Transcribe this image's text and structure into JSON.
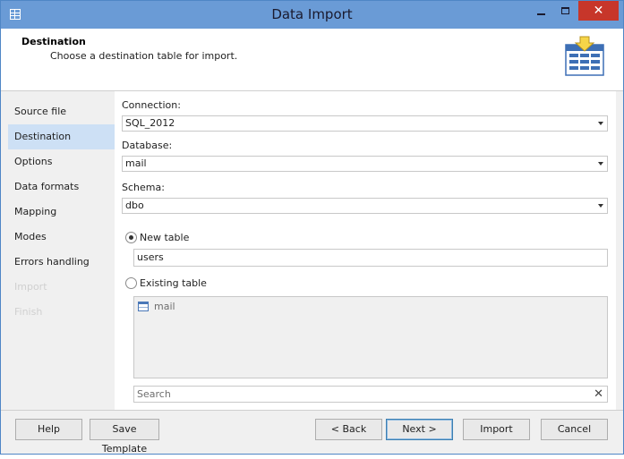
{
  "window": {
    "title": "Data Import",
    "close_glyph": "✕"
  },
  "header": {
    "title": "Destination",
    "subtitle": "Choose a destination table for import."
  },
  "sidebar": {
    "items": [
      {
        "label": "Source file",
        "state": "normal"
      },
      {
        "label": "Destination",
        "state": "active"
      },
      {
        "label": "Options",
        "state": "normal"
      },
      {
        "label": "Data formats",
        "state": "normal"
      },
      {
        "label": "Mapping",
        "state": "normal"
      },
      {
        "label": "Modes",
        "state": "normal"
      },
      {
        "label": "Errors handling",
        "state": "normal"
      },
      {
        "label": "Import",
        "state": "disabled"
      },
      {
        "label": "Finish",
        "state": "disabled"
      }
    ]
  },
  "form": {
    "connection": {
      "label": "Connection:",
      "value": "SQL_2012"
    },
    "database": {
      "label": "Database:",
      "value": "mail"
    },
    "schema": {
      "label": "Schema:",
      "value": "dbo"
    },
    "new_table": {
      "label": "New table",
      "selected": true,
      "value": "users"
    },
    "existing_table": {
      "label": "Existing table",
      "selected": false,
      "items": [
        "mail"
      ]
    },
    "search": {
      "placeholder": "Search",
      "clear_glyph": "✕"
    }
  },
  "footer": {
    "help": "Help",
    "save_template": "Save Template",
    "back": "< Back",
    "next": "Next >",
    "import": "Import",
    "cancel": "Cancel"
  },
  "colors": {
    "titlebar": "#6a9bd6",
    "close": "#c7362a",
    "active_item": "#cde0f5",
    "accent": "#3c7fb1"
  }
}
